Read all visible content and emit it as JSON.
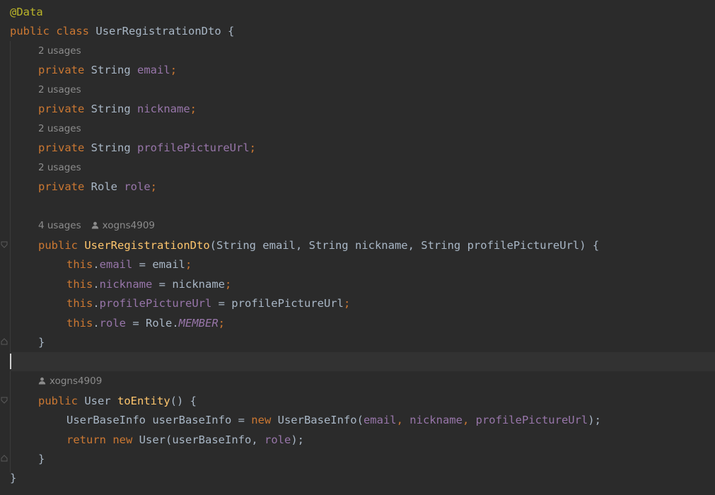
{
  "code": {
    "annotation": "@Data",
    "class_decl": {
      "kw_public": "public",
      "kw_class": "class",
      "name": "UserRegistrationDto",
      "brace": " {"
    },
    "usages_label": "2 usages",
    "fields": [
      {
        "kw": "private",
        "type": "String",
        "name": "email"
      },
      {
        "kw": "private",
        "type": "String",
        "name": "nickname"
      },
      {
        "kw": "private",
        "type": "String",
        "name": "profilePictureUrl"
      },
      {
        "kw": "private",
        "type": "Role",
        "name": "role"
      }
    ],
    "constructor": {
      "usages": "4 usages",
      "author": "xogns4909",
      "kw": "public",
      "name": "UserRegistrationDto",
      "params": "(String email, String nickname, String profilePictureUrl) {",
      "body": [
        {
          "this": "this",
          "field": "email",
          "rhs": " = email"
        },
        {
          "this": "this",
          "field": "nickname",
          "rhs": " = nickname"
        },
        {
          "this": "this",
          "field": "profilePictureUrl",
          "rhs": " = profilePictureUrl"
        },
        {
          "this": "this",
          "field": "role",
          "rhs_plain": " = Role.",
          "rhs_static": "MEMBER"
        }
      ],
      "close": "}"
    },
    "to_entity": {
      "author": "xogns4909",
      "kw": "public",
      "type": "User",
      "name": "toEntity",
      "sig_rest": "() {",
      "line1": {
        "decl": "UserBaseInfo userBaseInfo = ",
        "kw_new": "new",
        "ctor": " UserBaseInfo(",
        "a1": "email",
        "a2": "nickname",
        "a3": "profilePictureUrl",
        "end": ");"
      },
      "line2": {
        "kw_return": "return",
        "kw_new": "new",
        "call": " User(userBaseInfo, ",
        "arg": "role",
        "end": ");"
      },
      "close": "}"
    },
    "class_close": "}"
  }
}
